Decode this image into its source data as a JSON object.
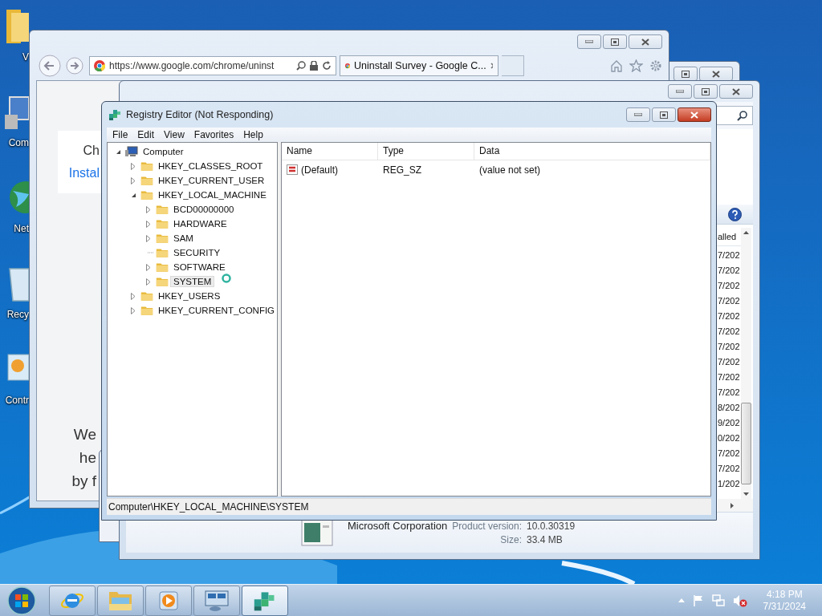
{
  "desktop_icons": [
    {
      "kind": "folder",
      "label": "V"
    },
    {
      "kind": "computer",
      "label": "Com"
    },
    {
      "kind": "network",
      "label": "Net"
    },
    {
      "kind": "recycle",
      "label": "Recy"
    },
    {
      "kind": "control",
      "label": "Contr"
    }
  ],
  "browser": {
    "url": "https://www.google.com/chrome/uninst",
    "tab": "Uninstall Survey - Google C...",
    "card_title": "Ch",
    "card_link": "Instal",
    "body_lines": [
      "We",
      "he",
      "by f"
    ]
  },
  "programs_window": {
    "column_header": "alled",
    "dates": [
      "7/202",
      "7/202",
      "7/202",
      "7/202",
      "7/202",
      "7/202",
      "7/202",
      "7/202",
      "7/202",
      "7/202",
      "8/202",
      "9/202",
      "0/202",
      "7/202",
      "7/202",
      "1/202"
    ],
    "publisher": "Microsoft Corporation",
    "version_label": "Product version:",
    "version": "10.0.30319",
    "size_label": "Size:",
    "size": "33.4 MB"
  },
  "regedit": {
    "title": "Registry Editor (Not Responding)",
    "menu": [
      "File",
      "Edit",
      "View",
      "Favorites",
      "Help"
    ],
    "tree": {
      "kind": "computer",
      "label": "Computer",
      "expandable": true,
      "expanded": true,
      "selected": false,
      "children": [
        {
          "kind": "folder",
          "label": "HKEY_CLASSES_ROOT",
          "expandable": true,
          "expanded": false,
          "selected": false
        },
        {
          "kind": "folder",
          "label": "HKEY_CURRENT_USER",
          "expandable": true,
          "expanded": false,
          "selected": false
        },
        {
          "kind": "folder",
          "label": "HKEY_LOCAL_MACHINE",
          "expandable": true,
          "expanded": true,
          "selected": false,
          "children": [
            {
              "kind": "folder",
              "label": "BCD00000000",
              "expandable": true,
              "expanded": false,
              "selected": false
            },
            {
              "kind": "folder",
              "label": "HARDWARE",
              "expandable": true,
              "expanded": false,
              "selected": false
            },
            {
              "kind": "folder",
              "label": "SAM",
              "expandable": true,
              "expanded": false,
              "selected": false
            },
            {
              "kind": "folder",
              "label": "SECURITY",
              "expandable": false,
              "expanded": false,
              "selected": false
            },
            {
              "kind": "folder",
              "label": "SOFTWARE",
              "expandable": true,
              "expanded": false,
              "selected": false
            },
            {
              "kind": "folder",
              "label": "SYSTEM",
              "expandable": true,
              "expanded": false,
              "selected": true
            }
          ]
        },
        {
          "kind": "folder",
          "label": "HKEY_USERS",
          "expandable": true,
          "expanded": false,
          "selected": false
        },
        {
          "kind": "folder",
          "label": "HKEY_CURRENT_CONFIG",
          "expandable": true,
          "expanded": false,
          "selected": false
        }
      ]
    },
    "columns": [
      "Name",
      "Type",
      "Data"
    ],
    "rows": [
      {
        "name": "(Default)",
        "type": "REG_SZ",
        "data": "(value not set)"
      }
    ],
    "status": "Computer\\HKEY_LOCAL_MACHINE\\SYSTEM"
  },
  "taskbar": {
    "apps": [
      {
        "kind": "ie",
        "selected": false
      },
      {
        "kind": "explorer",
        "selected": false
      },
      {
        "kind": "media",
        "selected": false
      },
      {
        "kind": "remote",
        "selected": false
      },
      {
        "kind": "regedit",
        "selected": true
      }
    ],
    "time": "4:18 PM",
    "date": "7/31/2024"
  }
}
